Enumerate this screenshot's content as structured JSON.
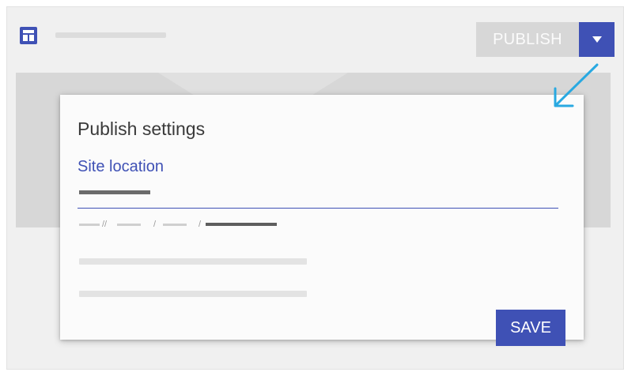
{
  "header": {
    "publish_label": "PUBLISH",
    "icon": "site-layout-icon",
    "dropdown_icon": "triangle-down-icon"
  },
  "dialog": {
    "title": "Publish settings",
    "field_label": "Site location",
    "url_separators": [
      "//",
      "/",
      "/"
    ],
    "save_label": "SAVE"
  },
  "annotation": {
    "icon": "pointer-arrow-icon",
    "color": "#29a9e1"
  },
  "colors": {
    "accent": "#3f51b5",
    "publish_disabled": "#d7d7d7"
  }
}
